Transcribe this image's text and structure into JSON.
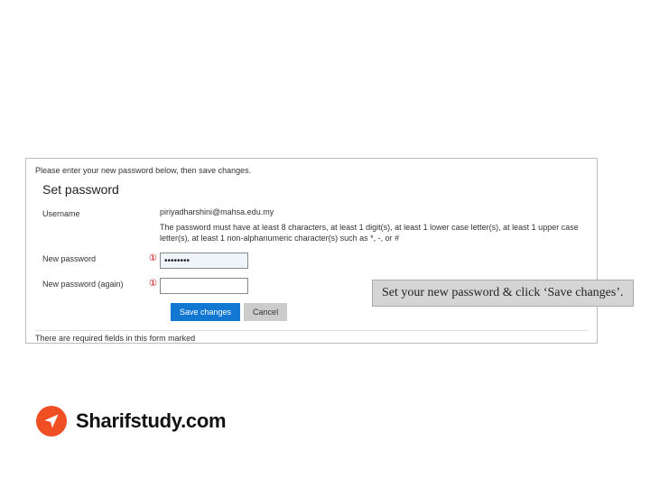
{
  "panel": {
    "instruction": "Please enter your new password below, then save changes.",
    "heading": "Set password",
    "username_label": "Username",
    "username_value": "piriyadharshini@mahsa.edu.my",
    "password_hint": "The password must have at least 8 characters, at least 1 digit(s), at least 1 lower case letter(s), at least 1 upper case letter(s), at least 1 non-alphanumeric character(s) such as *, -, or #",
    "new_password_label": "New password",
    "new_password_value": "••••••••",
    "new_password_again_label": "New password (again)",
    "new_password_again_value": "",
    "required_symbol": "①",
    "save_label": "Save changes",
    "cancel_label": "Cancel",
    "required_note": "There are required fields in this form marked"
  },
  "callout": "Set your new password & click ‘Save changes’.",
  "brand": {
    "name": "Sharifstudy.com"
  }
}
